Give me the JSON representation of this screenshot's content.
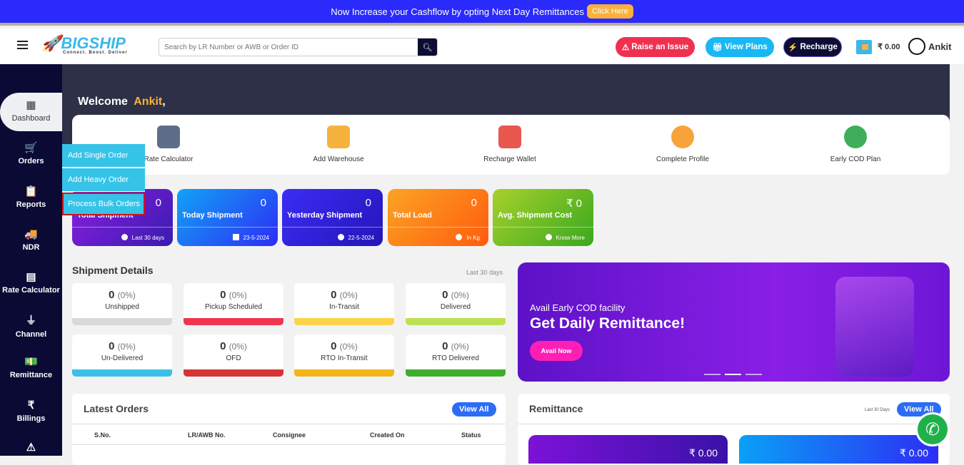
{
  "banner": {
    "text": "Now Increase your Cashflow by opting Next Day Remittances",
    "cta": "Click Here"
  },
  "header": {
    "logo": "BIGSHIP",
    "tagline": "Connect. Boost. Deliver",
    "search_placeholder": "Search by LR Number or AWB or Order ID",
    "raise_issue": "Raise an Issue",
    "view_plans": "View Plans",
    "recharge": "Recharge",
    "balance": "₹ 0.00",
    "user": "Ankit"
  },
  "sidebar": {
    "items": [
      {
        "label": "Dashboard",
        "icon": "▦"
      },
      {
        "label": "Orders",
        "icon": "🛒"
      },
      {
        "label": "Reports",
        "icon": "📋"
      },
      {
        "label": "NDR",
        "icon": "🚚"
      },
      {
        "label": "Rate Calculator",
        "icon": "▤"
      },
      {
        "label": "Channel",
        "icon": "⏚"
      },
      {
        "label": "Remittance",
        "icon": "💵"
      },
      {
        "label": "Billings",
        "icon": "₹"
      },
      {
        "label": "",
        "icon": "⚠"
      }
    ]
  },
  "orders_menu": [
    "Add Single Order",
    "Add Heavy Order",
    "Process Bulk Orders"
  ],
  "welcome": {
    "prefix": "Welcome",
    "name": "Ankit",
    ",": ","
  },
  "quick_actions": [
    "Rate Calculator",
    "Add Warehouse",
    "Recharge Wallet",
    "Complete Profile",
    "Early COD Plan"
  ],
  "stats": [
    {
      "label": "Total Shipment",
      "value": "0",
      "foot": "Last 30 days"
    },
    {
      "label": "Today Shipment",
      "value": "0",
      "foot": "23-5-2024"
    },
    {
      "label": "Yesterday Shipment",
      "value": "0",
      "foot": "22-5-2024"
    },
    {
      "label": "Total Load",
      "value": "0",
      "foot": "In Kg"
    },
    {
      "label": "Avg. Shipment Cost",
      "value": "₹ 0",
      "foot": "Know More"
    }
  ],
  "shipment_details": {
    "title": "Shipment Details",
    "period": "Last 30 days",
    "items": [
      {
        "label": "Unshipped",
        "count": "0",
        "pct": "(0%)",
        "color": "#d9d9d9"
      },
      {
        "label": "Pickup Scheduled",
        "count": "0",
        "pct": "(0%)",
        "color": "#f0364f"
      },
      {
        "label": "In-Transit",
        "count": "0",
        "pct": "(0%)",
        "color": "#fdd34a"
      },
      {
        "label": "Delivered",
        "count": "0",
        "pct": "(0%)",
        "color": "#bde153"
      },
      {
        "label": "Un-Delivered",
        "count": "0",
        "pct": "(0%)",
        "color": "#3ac0e7"
      },
      {
        "label": "OFD",
        "count": "0",
        "pct": "(0%)",
        "color": "#d63434"
      },
      {
        "label": "RTO In-Transit",
        "count": "0",
        "pct": "(0%)",
        "color": "#f2b519"
      },
      {
        "label": "RTO Delivered",
        "count": "0",
        "pct": "(0%)",
        "color": "#3fae2a"
      }
    ]
  },
  "promo": {
    "line1": "Avail Early COD facility",
    "line2": "Get Daily Remittance!",
    "button": "Avail Now"
  },
  "latest_orders": {
    "title": "Latest Orders",
    "view_all": "View All",
    "columns": [
      "S.No.",
      "LR/AWB No.",
      "Consignee",
      "Created On",
      "Status"
    ]
  },
  "remittance": {
    "title": "Remittance",
    "period": "Last 30 Days",
    "view_all": "View All",
    "cards": [
      "₹ 0.00",
      "₹ 0.00"
    ]
  }
}
